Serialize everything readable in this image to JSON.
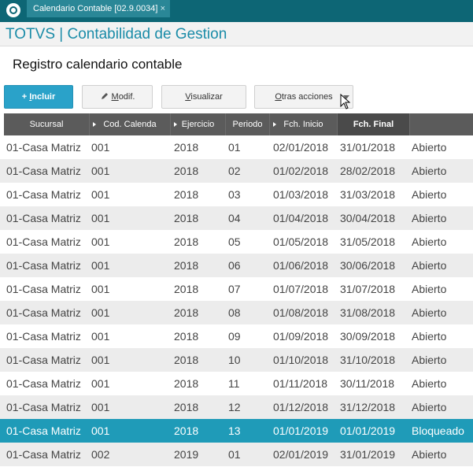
{
  "tab": {
    "label": "Calendario Contable [02.9.0034]",
    "close": "×"
  },
  "app": {
    "title": "TOTVS | Contabilidad de Gestion"
  },
  "page": {
    "title": "Registro calendario contable"
  },
  "toolbar": {
    "incluir": {
      "prefix": "+ ",
      "accel": "I",
      "rest": "ncluir"
    },
    "modif": {
      "accel": "M",
      "rest": "odif."
    },
    "visualizar": {
      "accel": "V",
      "rest": "isualizar"
    },
    "otras": {
      "accel": "O",
      "rest": "tras acciones"
    }
  },
  "table": {
    "columns": [
      "Sucursal",
      "Cod. Calenda",
      "Ejercicio",
      "Periodo",
      "Fch. Inicio",
      "Fch. Final",
      ""
    ],
    "rows": [
      [
        "01-Casa Matriz",
        "001",
        "2018",
        "01",
        "02/01/2018",
        "31/01/2018",
        "Abierto"
      ],
      [
        "01-Casa Matriz",
        "001",
        "2018",
        "02",
        "01/02/2018",
        "28/02/2018",
        "Abierto"
      ],
      [
        "01-Casa Matriz",
        "001",
        "2018",
        "03",
        "01/03/2018",
        "31/03/2018",
        "Abierto"
      ],
      [
        "01-Casa Matriz",
        "001",
        "2018",
        "04",
        "01/04/2018",
        "30/04/2018",
        "Abierto"
      ],
      [
        "01-Casa Matriz",
        "001",
        "2018",
        "05",
        "01/05/2018",
        "31/05/2018",
        "Abierto"
      ],
      [
        "01-Casa Matriz",
        "001",
        "2018",
        "06",
        "01/06/2018",
        "30/06/2018",
        "Abierto"
      ],
      [
        "01-Casa Matriz",
        "001",
        "2018",
        "07",
        "01/07/2018",
        "31/07/2018",
        "Abierto"
      ],
      [
        "01-Casa Matriz",
        "001",
        "2018",
        "08",
        "01/08/2018",
        "31/08/2018",
        "Abierto"
      ],
      [
        "01-Casa Matriz",
        "001",
        "2018",
        "09",
        "01/09/2018",
        "30/09/2018",
        "Abierto"
      ],
      [
        "01-Casa Matriz",
        "001",
        "2018",
        "10",
        "01/10/2018",
        "31/10/2018",
        "Abierto"
      ],
      [
        "01-Casa Matriz",
        "001",
        "2018",
        "11",
        "01/11/2018",
        "30/11/2018",
        "Abierto"
      ],
      [
        "01-Casa Matriz",
        "001",
        "2018",
        "12",
        "01/12/2018",
        "31/12/2018",
        "Abierto"
      ],
      [
        "01-Casa Matriz",
        "001",
        "2018",
        "13",
        "01/01/2019",
        "01/01/2019",
        "Bloqueado"
      ],
      [
        "01-Casa Matriz",
        "002",
        "2019",
        "01",
        "02/01/2019",
        "31/01/2019",
        "Abierto"
      ]
    ],
    "selected_row": 12
  },
  "colors": {
    "topbar": "#0d6675",
    "title": "#1a8ca8",
    "primary": "#2aa2c9",
    "selected": "#1f9bb8"
  },
  "icons": {
    "logo": "totvs-logo-icon",
    "edit": "pencil-icon",
    "cursor": "mouse-pointer-icon"
  }
}
